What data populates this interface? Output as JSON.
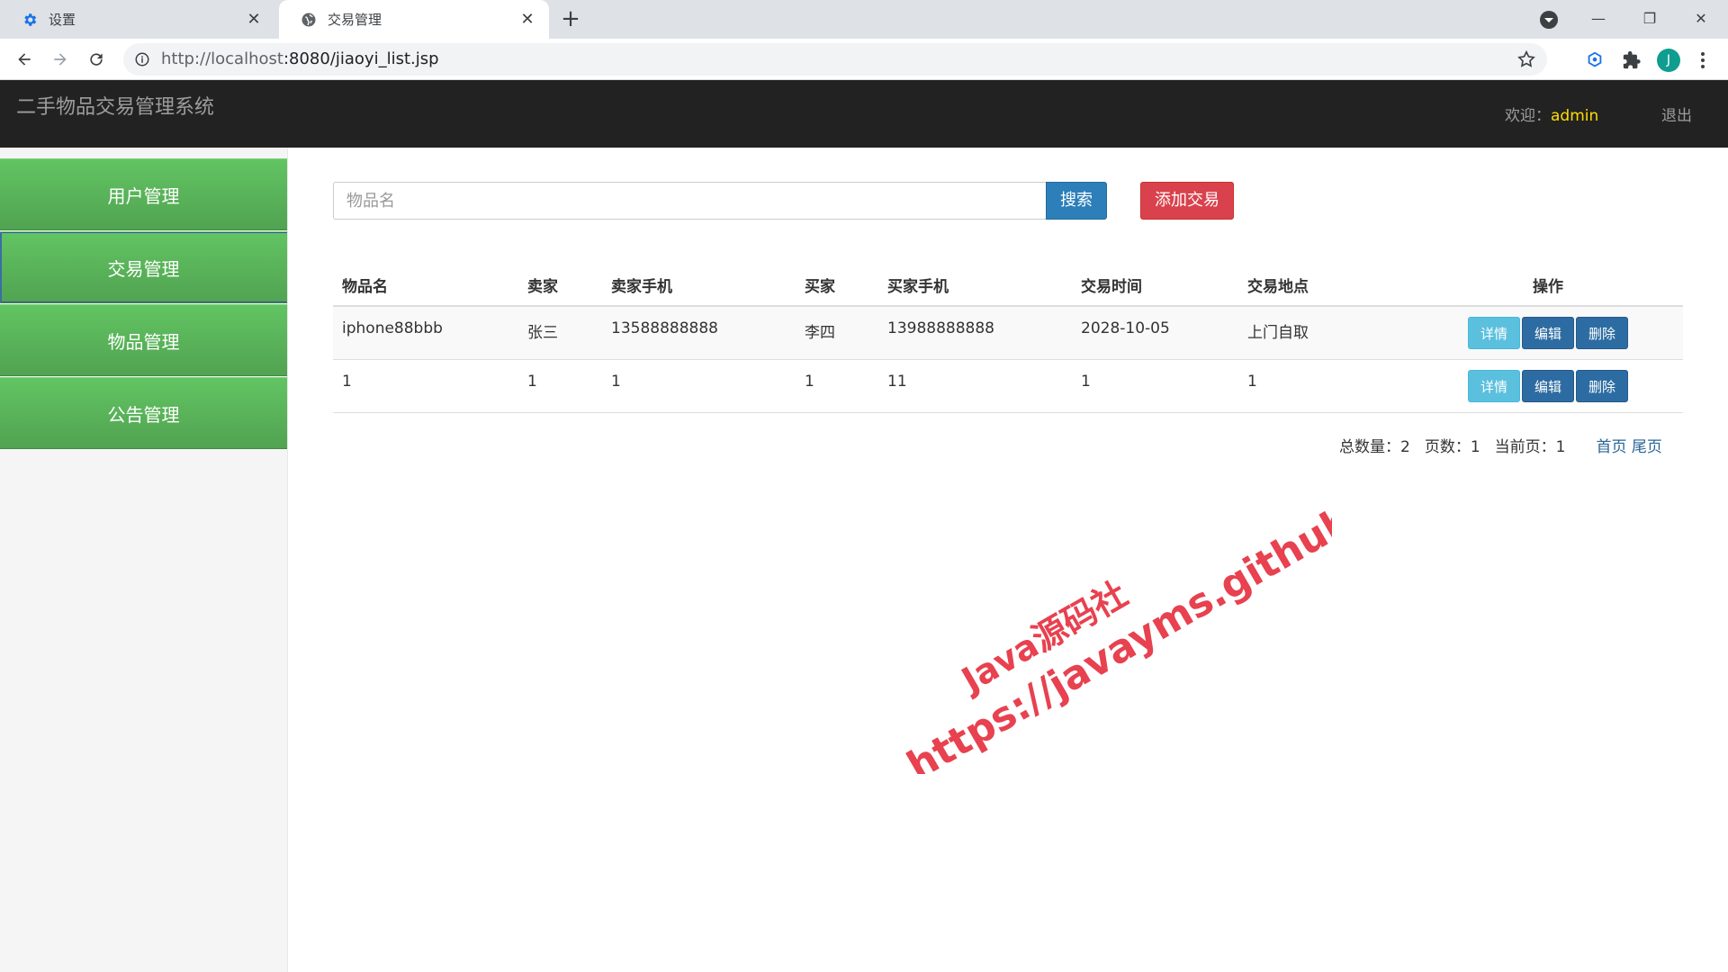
{
  "browser": {
    "tabs": [
      {
        "label": "设置",
        "icon": "gear-icon"
      },
      {
        "label": "交易管理",
        "icon": "globe-icon"
      }
    ],
    "url": "http://localhost:8080/jiaoyi_list.jsp",
    "url_host": "http://localhost",
    "url_rest": ":8080/jiaoyi_list.jsp",
    "avatar_letter": "J"
  },
  "app": {
    "title": "二手物品交易管理系统",
    "welcome_label": "欢迎：",
    "username": "admin",
    "logout_label": "退出"
  },
  "sidebar": {
    "items": [
      {
        "label": "用户管理"
      },
      {
        "label": "交易管理"
      },
      {
        "label": "物品管理"
      },
      {
        "label": "公告管理"
      }
    ]
  },
  "search": {
    "placeholder": "物品名",
    "search_label": "搜索",
    "add_label": "添加交易"
  },
  "table": {
    "headers": [
      "物品名",
      "卖家",
      "卖家手机",
      "买家",
      "买家手机",
      "交易时间",
      "交易地点",
      "操作"
    ],
    "rows": [
      [
        "iphone88bbb",
        "张三",
        "13588888888",
        "李四",
        "13988888888",
        "2028-10-05",
        "上门自取"
      ],
      [
        "1",
        "1",
        "1",
        "1",
        "11",
        "1",
        "1"
      ]
    ],
    "op_labels": {
      "detail": "详情",
      "edit": "编辑",
      "delete": "删除"
    }
  },
  "pager": {
    "total_label": "总数量：2",
    "pages_label": "页数：1",
    "current_label": "当前页：1",
    "first_label": "首页",
    "last_label": "尾页"
  },
  "watermark": {
    "line1": "Java源码社",
    "line2": "https://javayms.github.io"
  },
  "colors": {
    "header_bg": "#222222",
    "sidebar_green": "#5cb85c",
    "search_btn": "#2d7fb9",
    "add_btn": "#d9424d",
    "username": "#ffdd00",
    "watermark": "#e8414f"
  }
}
